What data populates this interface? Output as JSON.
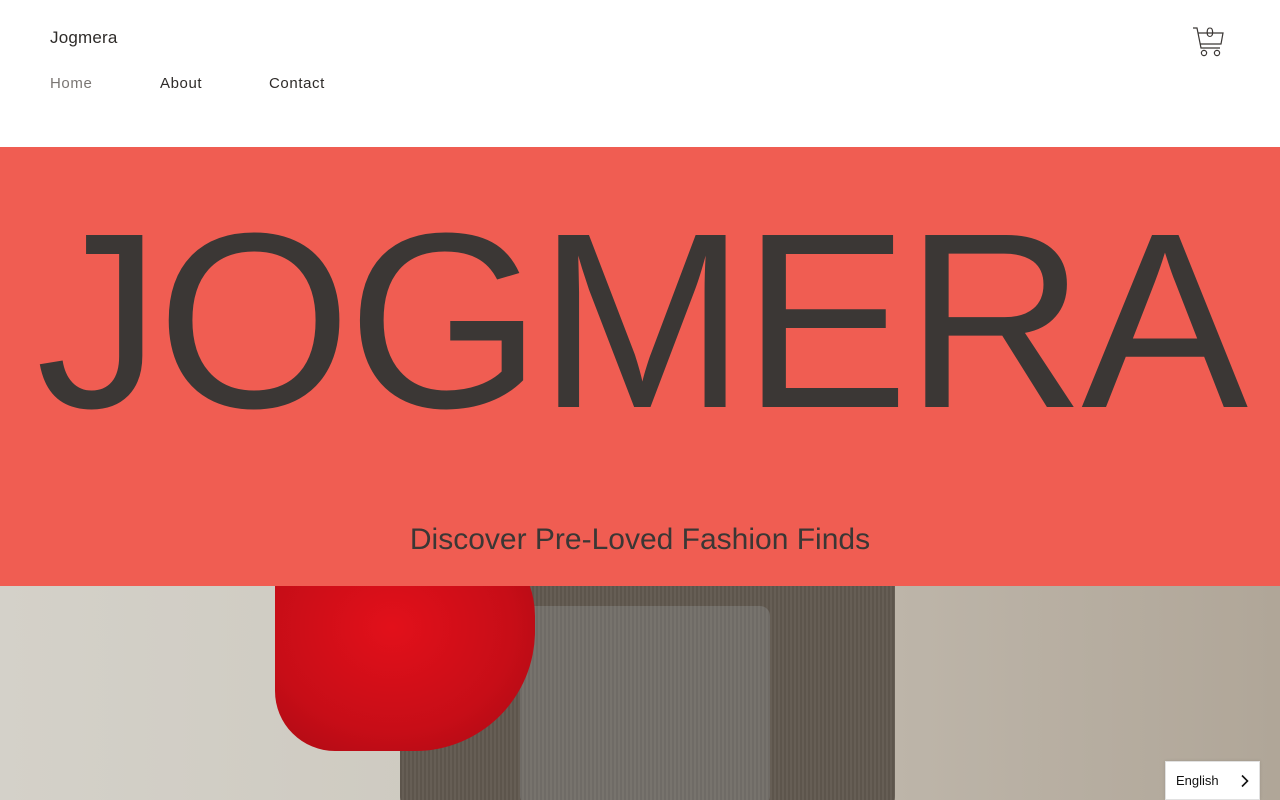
{
  "header": {
    "brand": "Jogmera",
    "nav": [
      {
        "label": "Home",
        "active": true
      },
      {
        "label": "About",
        "active": false
      },
      {
        "label": "Contact",
        "active": false
      }
    ],
    "cart": {
      "count": "0",
      "icon": "cart-icon"
    }
  },
  "hero": {
    "title": "JOGMERA",
    "subtitle": "Discover Pre-Loved Fashion Finds",
    "background": "#f05d52",
    "text_color": "#3b3735"
  },
  "language": {
    "selected": "English",
    "icon": "chevron-right-icon"
  }
}
